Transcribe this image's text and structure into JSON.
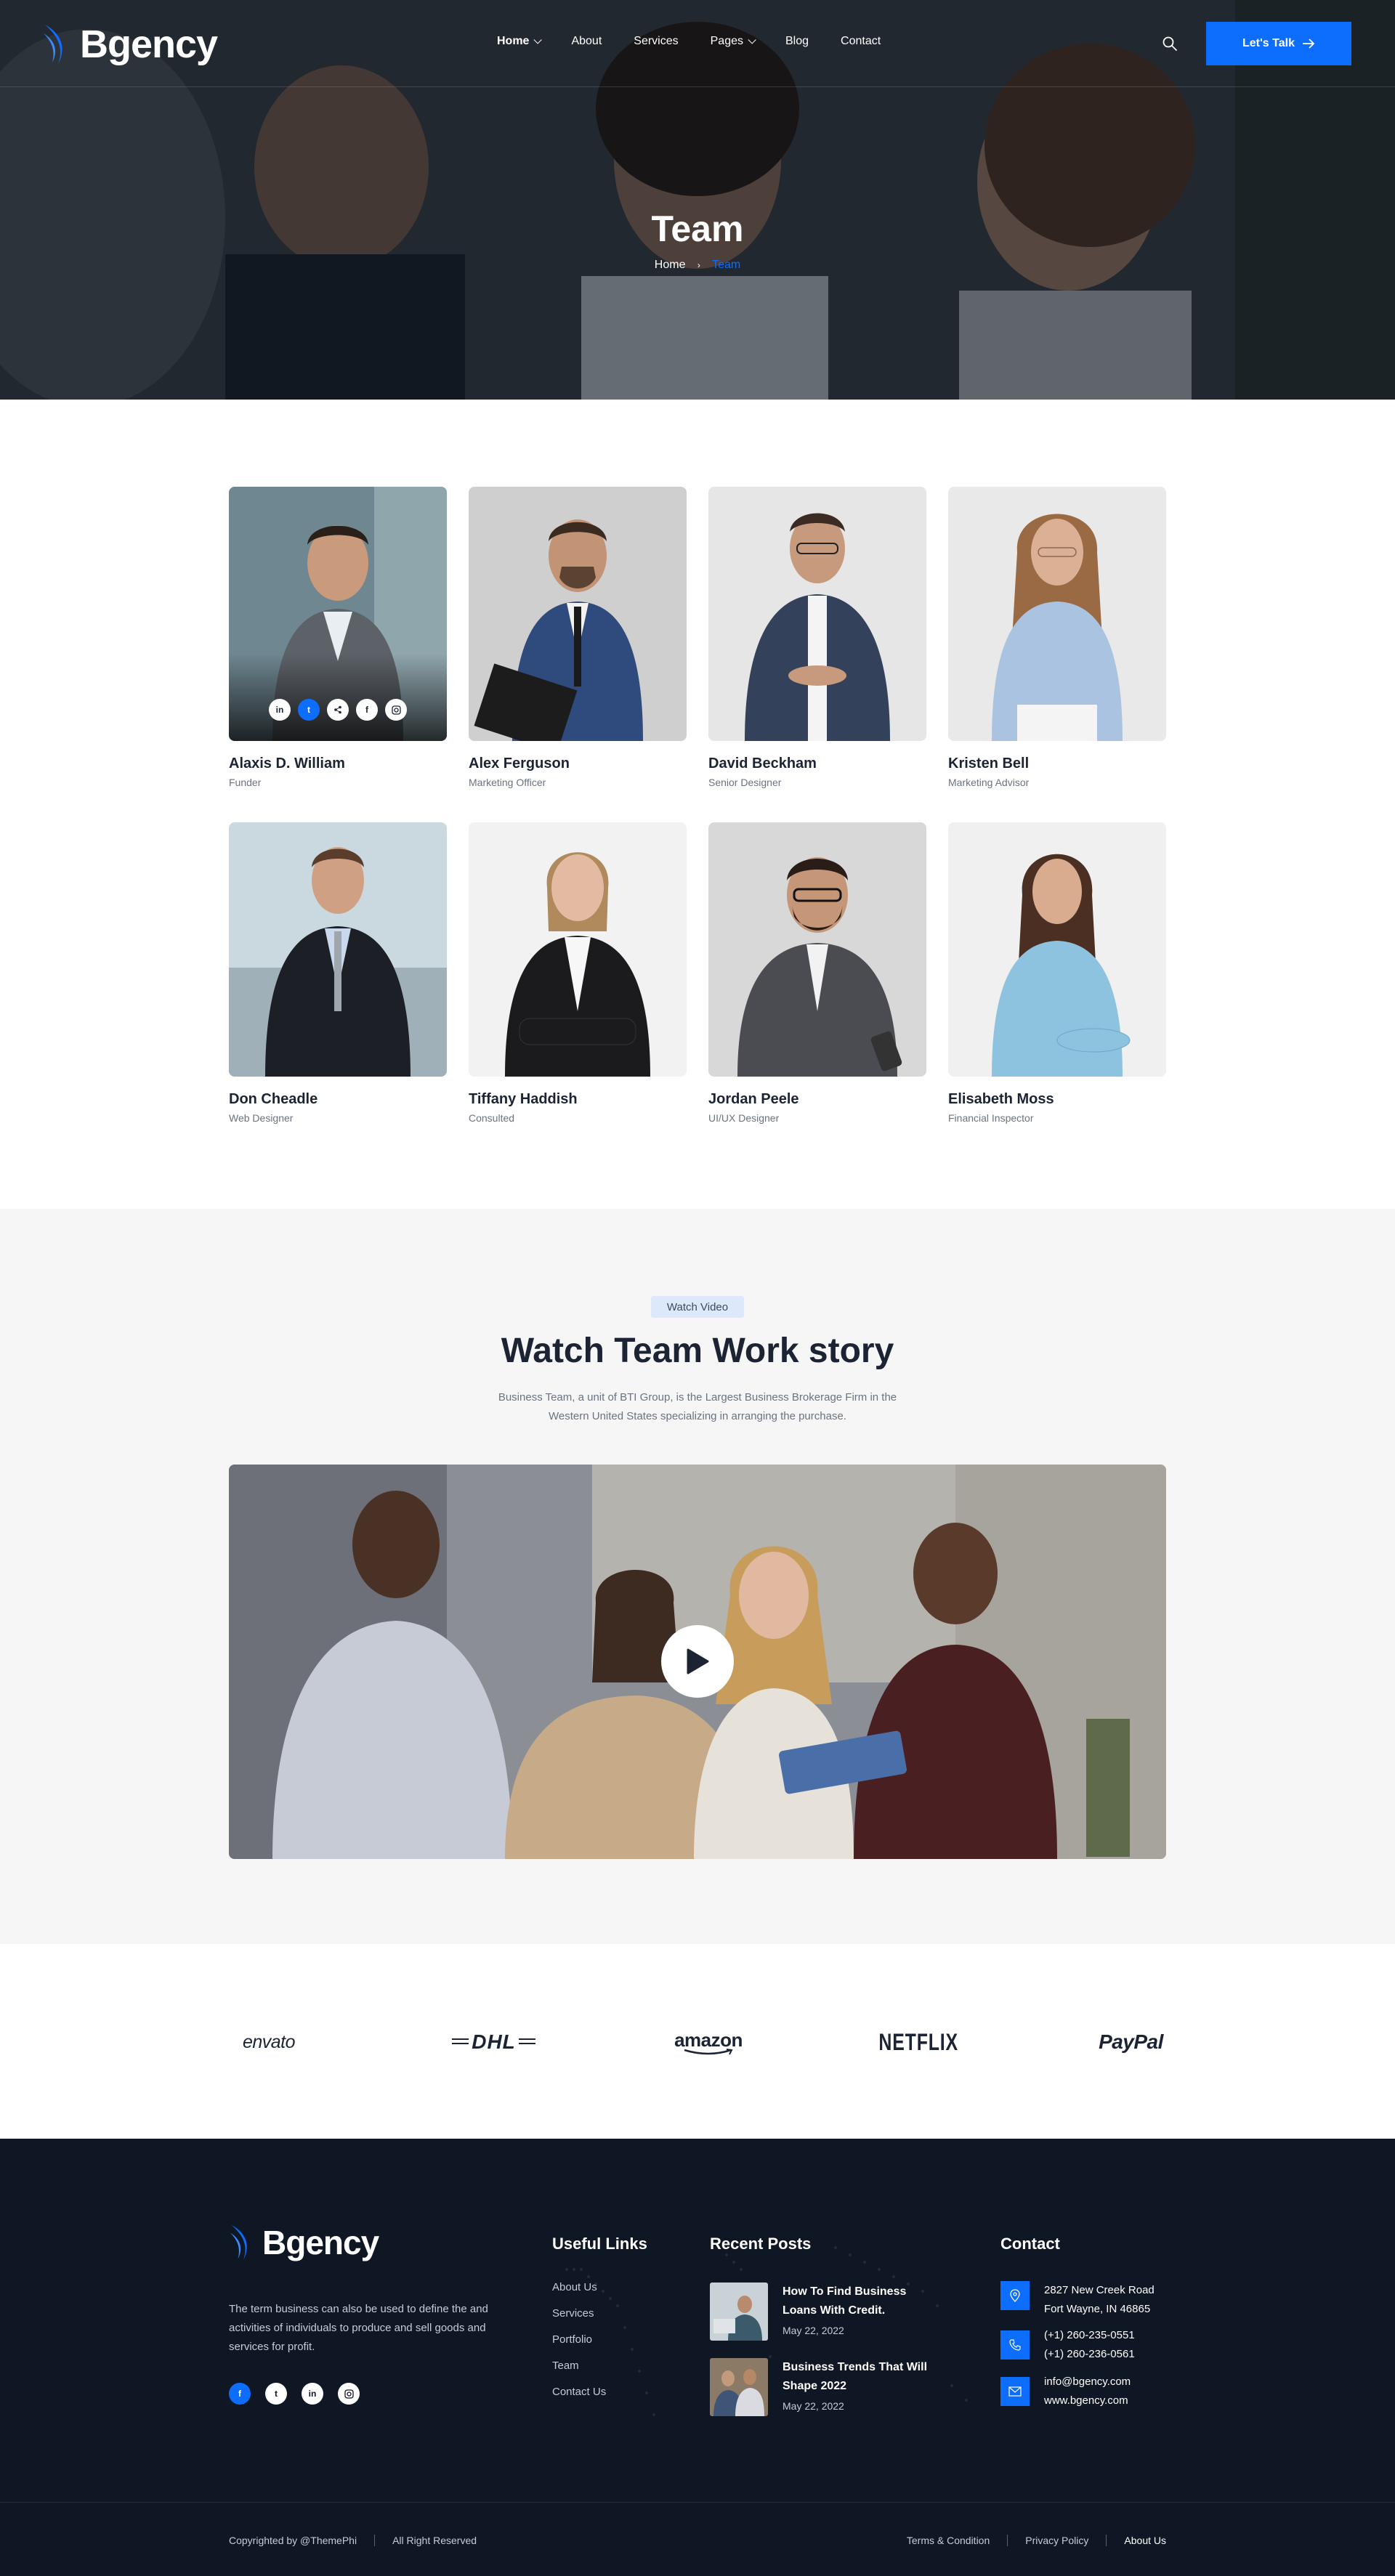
{
  "header": {
    "brand": "Bgency",
    "menu": [
      {
        "label": "Home",
        "dropdown": true,
        "active": true
      },
      {
        "label": "About",
        "dropdown": false
      },
      {
        "label": "Services",
        "dropdown": false
      },
      {
        "label": "Pages",
        "dropdown": true
      },
      {
        "label": "Blog",
        "dropdown": false
      },
      {
        "label": "Contact",
        "dropdown": false
      }
    ],
    "search_icon": "search-icon",
    "cta_label": "Let's Talk",
    "cta_icon": "arrow-right-icon"
  },
  "hero": {
    "title": "Team",
    "breadcrumb_home": "Home",
    "breadcrumb_separator": "›",
    "breadcrumb_current": "Team"
  },
  "team": {
    "members": [
      {
        "name": "Alaxis D. William",
        "role": "Funder"
      },
      {
        "name": "Alex Ferguson",
        "role": "Marketing Officer"
      },
      {
        "name": "David Beckham",
        "role": "Senior Designer"
      },
      {
        "name": "Kristen Bell",
        "role": "Marketing Advisor"
      },
      {
        "name": "Don Cheadle",
        "role": "Web Designer"
      },
      {
        "name": "Tiffany Haddish",
        "role": "Consulted"
      },
      {
        "name": "Jordan Peele",
        "role": "UI/UX Designer"
      },
      {
        "name": "Elisabeth Moss",
        "role": "Financial Inspector"
      }
    ],
    "hover_socials": [
      "in",
      "t",
      "share",
      "f",
      "ig"
    ]
  },
  "video": {
    "tag": "Watch Video",
    "title": "Watch Team Work story",
    "description": "Business Team, a unit of BTI Group, is the Largest Business Brokerage Firm in the Western United States specializing in arranging the purchase.",
    "play_icon": "play-icon"
  },
  "brands": [
    "envato",
    "DHL",
    "amazon",
    "NETFLIX",
    "PayPal"
  ],
  "footer": {
    "brand": "Bgency",
    "about": "The term business can also be used to define the and activities of individuals to produce and sell goods and services for profit.",
    "socials": [
      "f",
      "t",
      "in",
      "ig"
    ],
    "useful_title": "Useful Links",
    "useful_links": [
      "About Us",
      "Services",
      "Portfolio",
      "Team",
      "Contact Us"
    ],
    "posts_title": "Recent Posts",
    "posts": [
      {
        "title": "How To Find Business Loans With Credit.",
        "date": "May 22, 2022"
      },
      {
        "title": "Business Trends That Will Shape 2022",
        "date": "May 22, 2022"
      }
    ],
    "contact_title": "Contact",
    "address_line1": "2827 New Creek Road",
    "address_line2": "Fort Wayne, IN 46865",
    "phone1": "(+1) 260-235-0551",
    "phone2": "(+1) 260-236-0561",
    "email": "info@bgency.com",
    "website": "www.bgency.com",
    "copyright": "Copyrighted by @ThemePhi",
    "rights": "All Right Reserved",
    "legal": [
      "Terms & Condition",
      "Privacy Policy",
      "About Us"
    ]
  },
  "colors": {
    "accent": "#0d6efd",
    "dark": "#0f1624",
    "heading": "#1c2434",
    "muted": "#6b7280"
  }
}
